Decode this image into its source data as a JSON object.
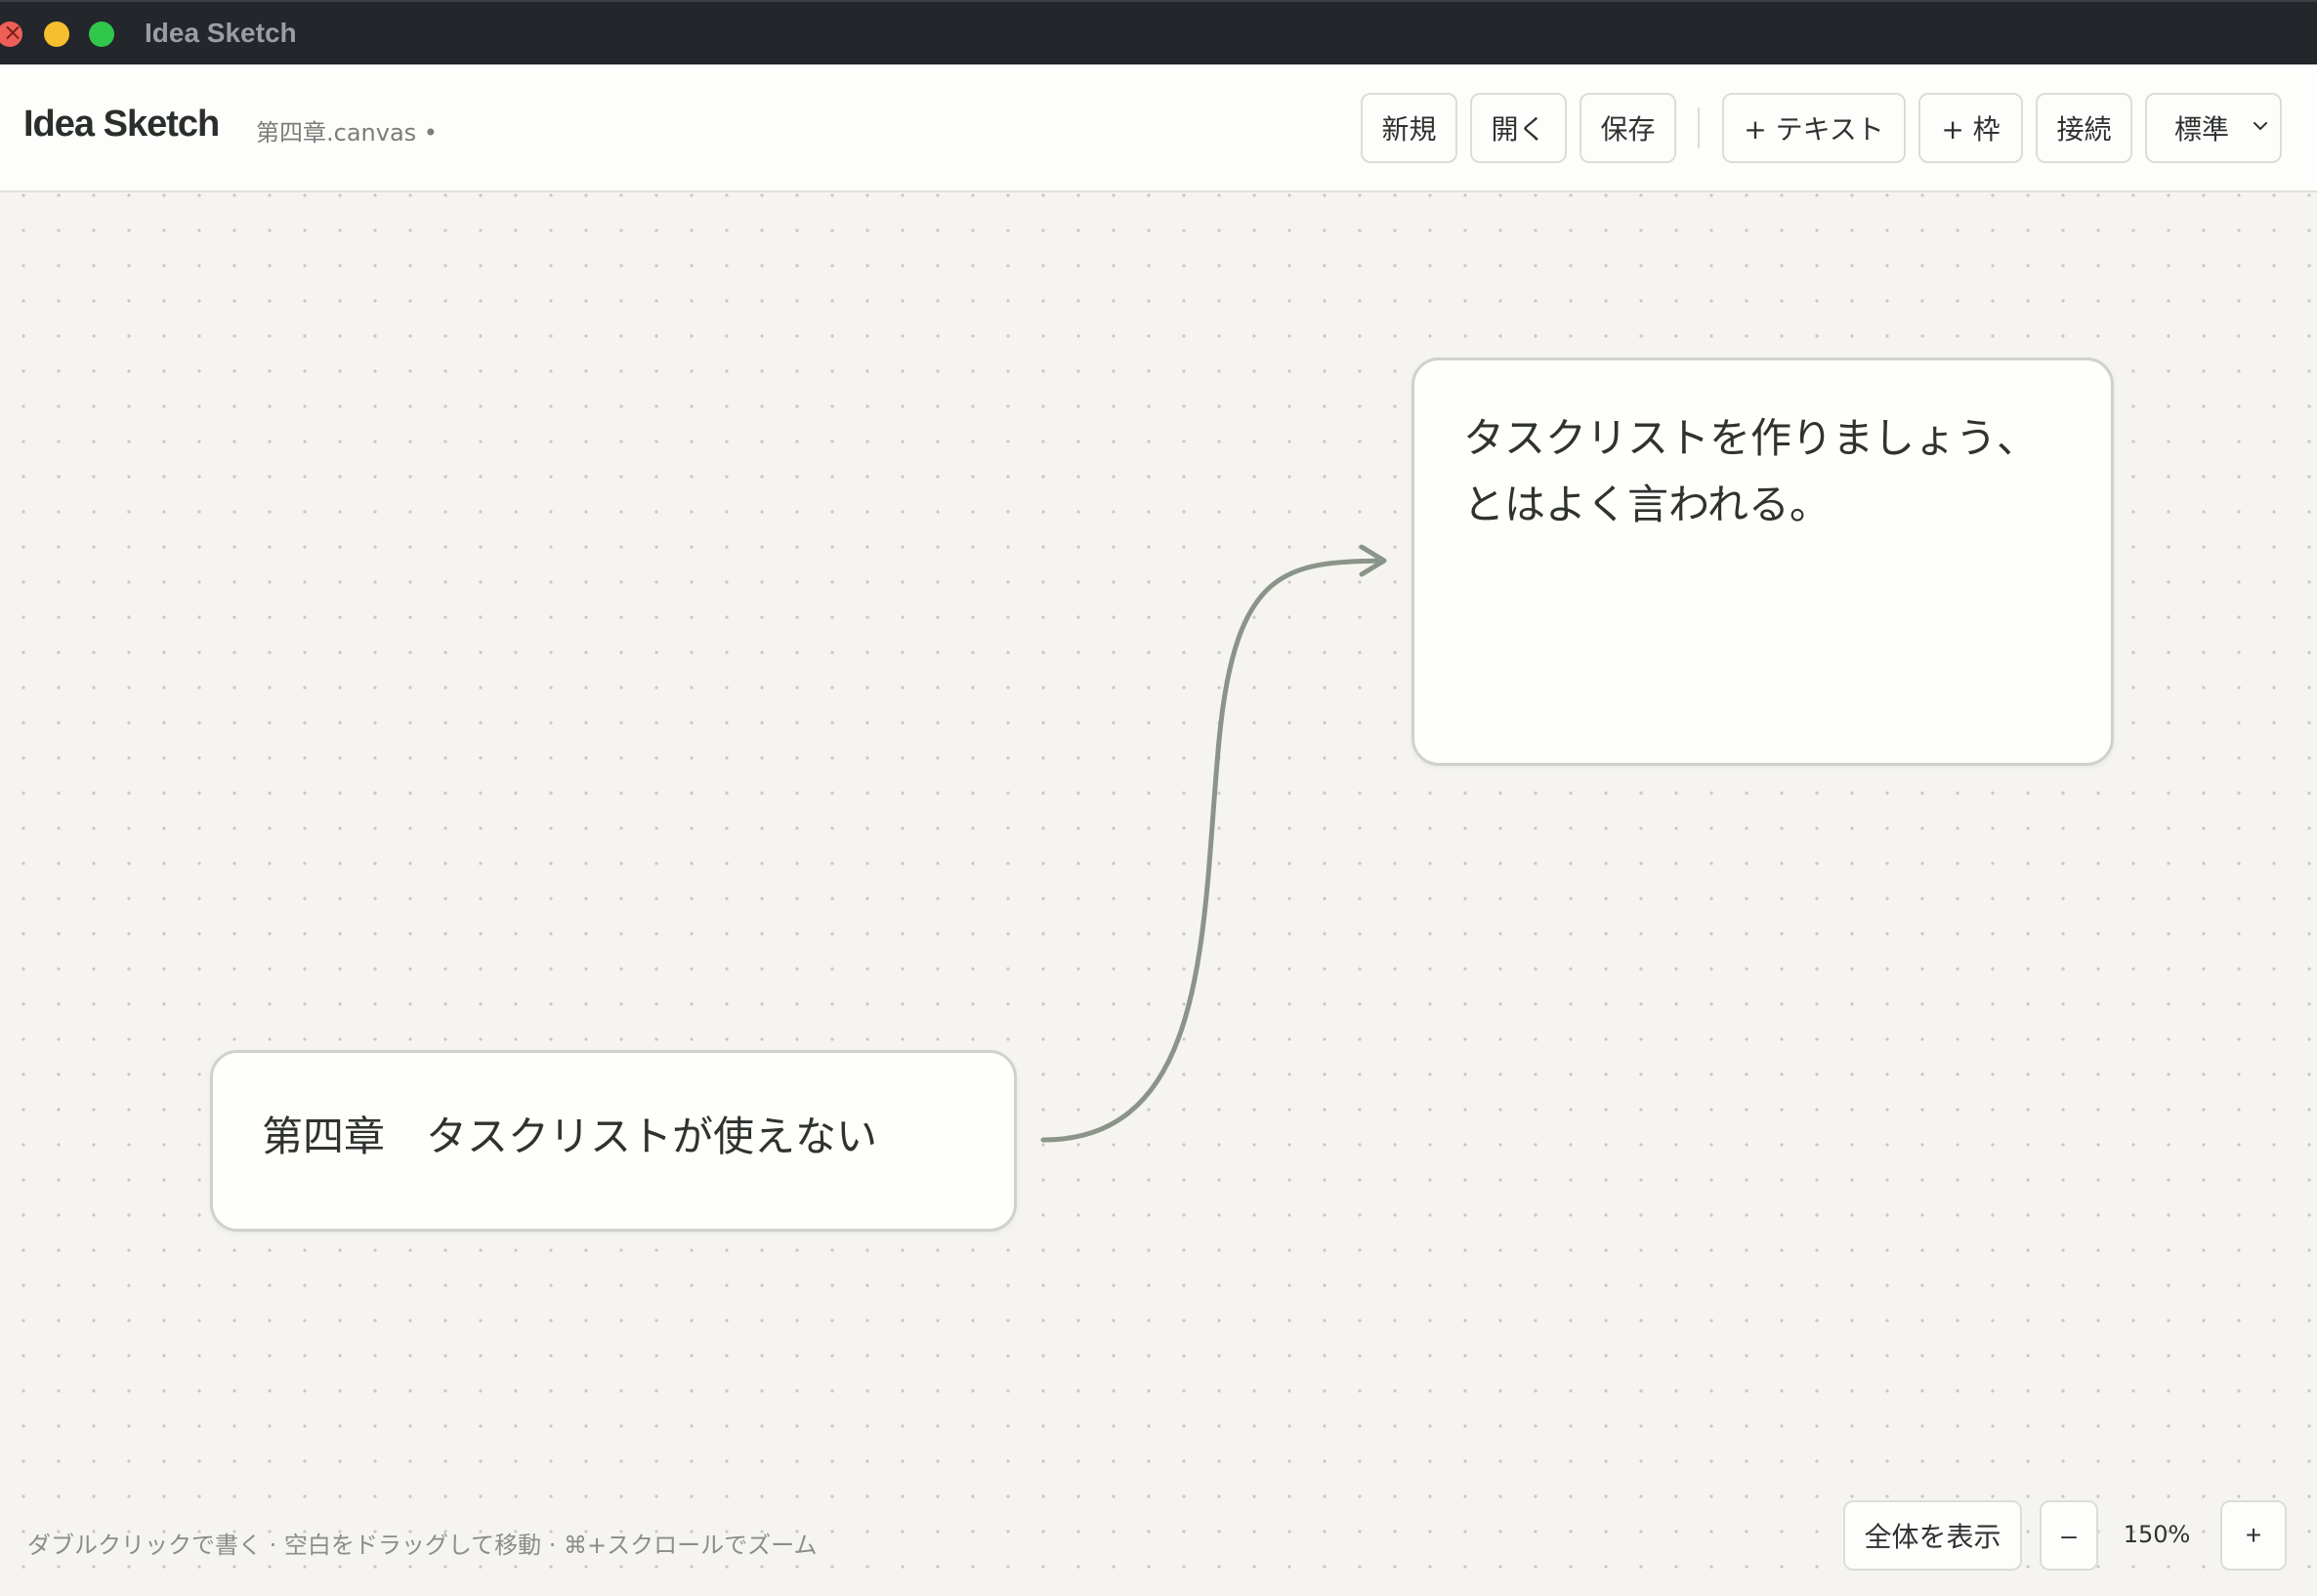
{
  "window": {
    "title": "Idea Sketch"
  },
  "toolbar": {
    "app_name": "Idea Sketch",
    "file_name": "第四章.canvas •",
    "buttons": {
      "new": "新規",
      "open": "開く",
      "save": "保存",
      "add_text": "+ テキスト",
      "add_frame": "+ 枠",
      "connect": "接続"
    },
    "style_select": {
      "selected": "標準"
    }
  },
  "canvas": {
    "nodes": [
      {
        "text": "タスクリストを作りましょう、\nとはよく言われる。"
      },
      {
        "text": "第四章　タスクリストが使えない"
      }
    ],
    "edge_color": "#8a9489"
  },
  "footer": {
    "hint": "ダブルクリックで書く · 空白をドラッグして移動 · ⌘+スクロールでズーム",
    "fit_label": "全体を表示",
    "zoom_out_label": "–",
    "zoom_level": "150%",
    "zoom_in_label": "+"
  }
}
